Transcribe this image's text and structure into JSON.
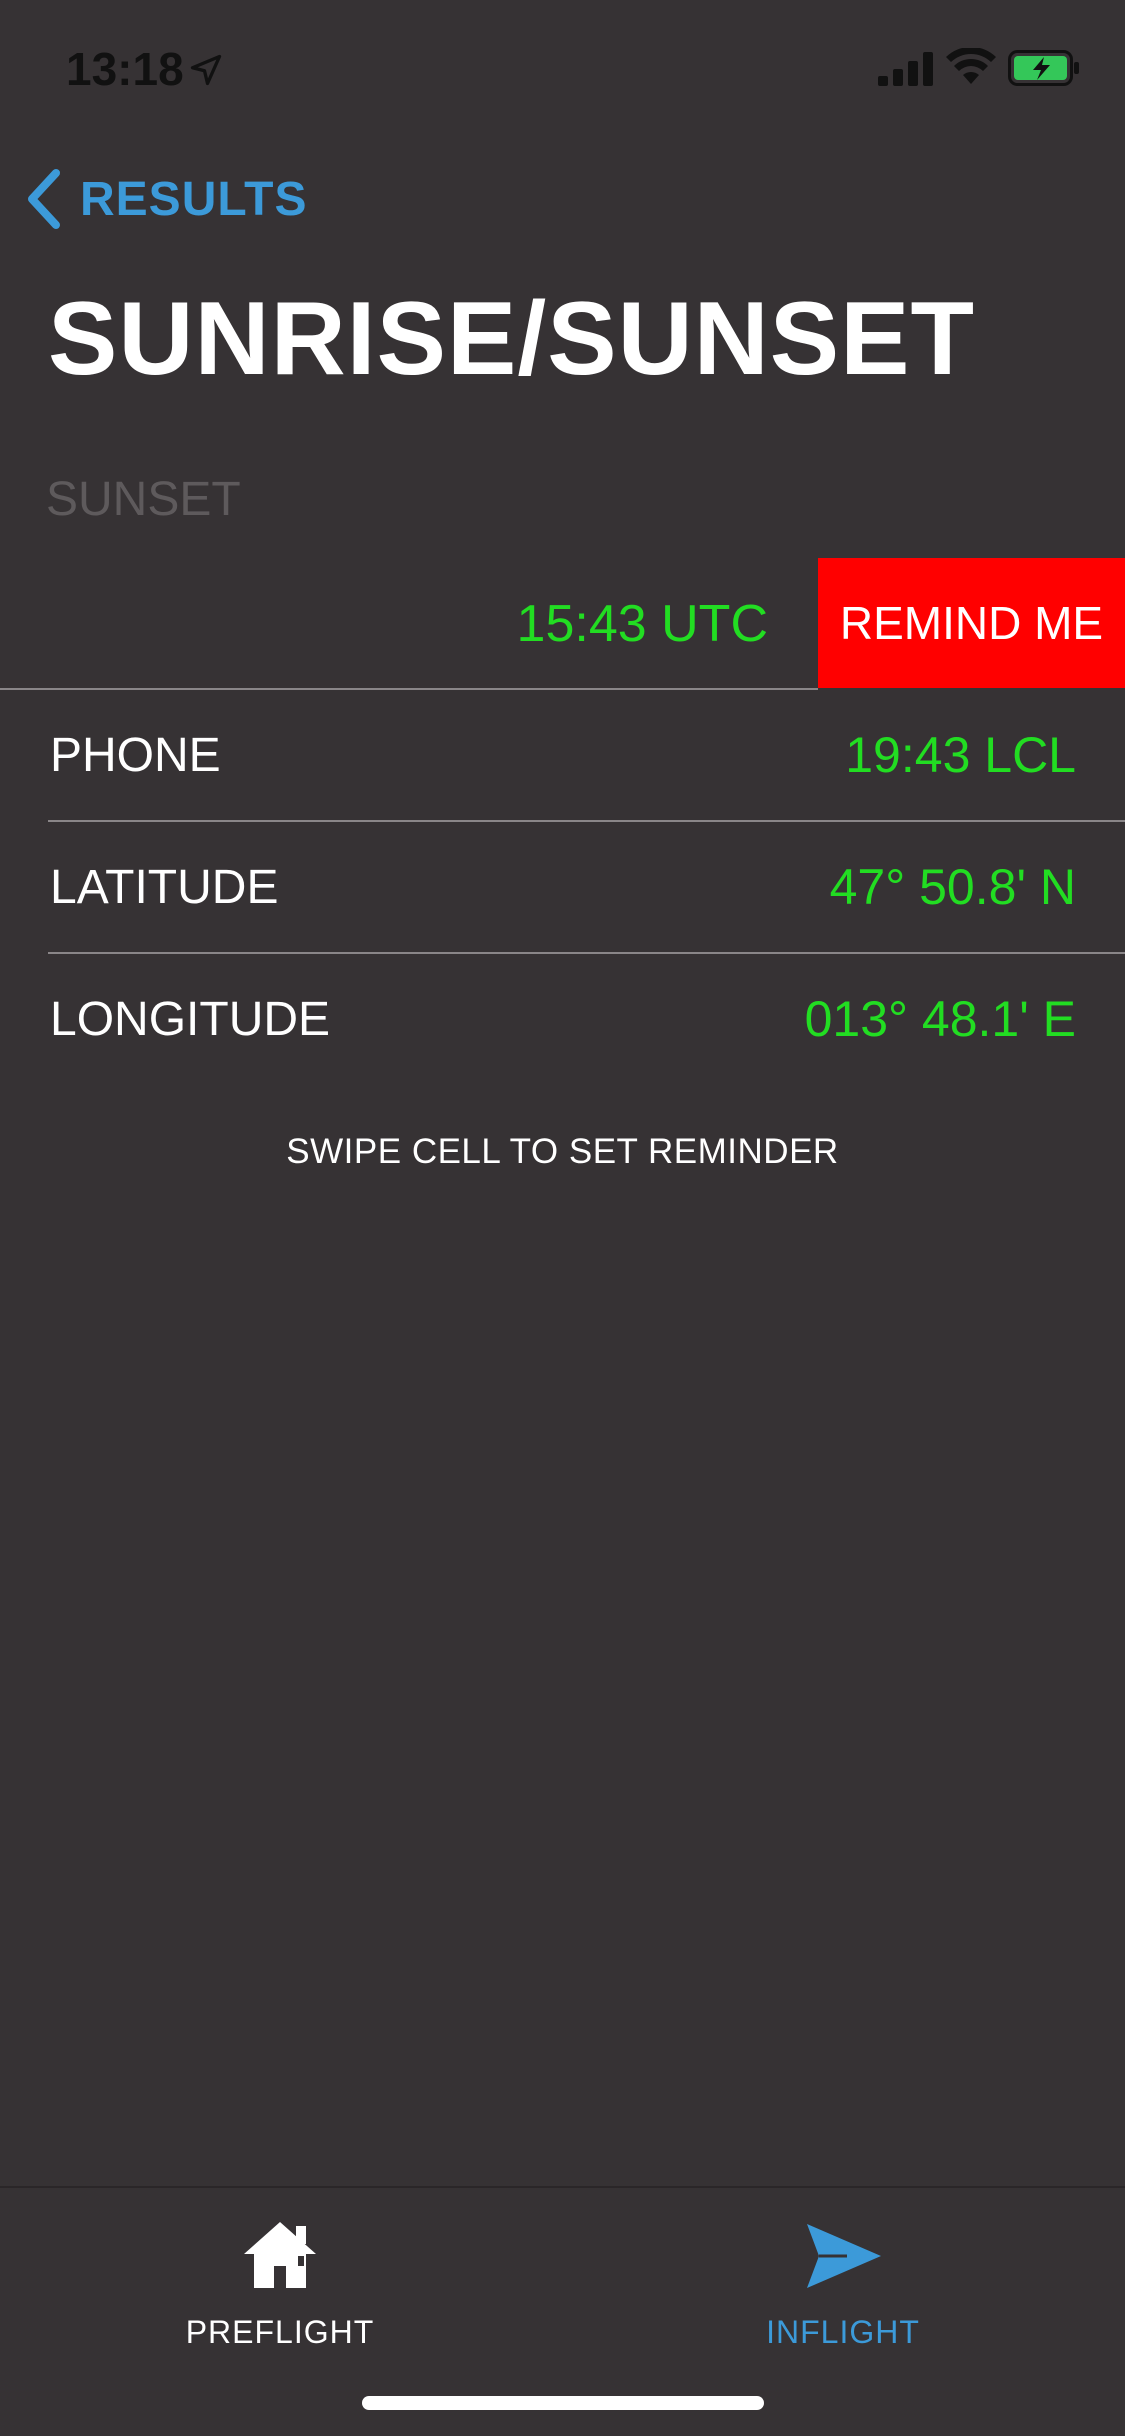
{
  "status_bar": {
    "time": "13:18",
    "icons": [
      "location-arrow-icon",
      "cellular-signal-icon",
      "wifi-icon",
      "battery-charging-icon"
    ]
  },
  "nav": {
    "back_label": "RESULTS",
    "back_icon": "chevron-left-icon"
  },
  "page": {
    "title": "SUNRISE/SUNSET"
  },
  "section": {
    "header": "SUNSET",
    "swiped_cell": {
      "value": "15:43 UTC",
      "action_label": "REMIND ME"
    },
    "rows": [
      {
        "label": "PHONE",
        "value": "19:43 LCL"
      },
      {
        "label": "LATITUDE",
        "value": "47° 50.8' N"
      },
      {
        "label": "LONGITUDE",
        "value": "013° 48.1' E"
      }
    ],
    "hint": "SWIPE CELL TO SET REMINDER"
  },
  "tab_bar": {
    "tabs": [
      {
        "label": "PREFLIGHT",
        "icon": "house-icon",
        "selected": false
      },
      {
        "label": "INFLIGHT",
        "icon": "paper-plane-icon",
        "selected": true
      }
    ]
  },
  "colors": {
    "background": "#363234",
    "accent_blue": "#3c9ad9",
    "value_green": "#22dd22",
    "destructive_red": "#ff0000",
    "section_header_gray": "#5e5a5c"
  }
}
